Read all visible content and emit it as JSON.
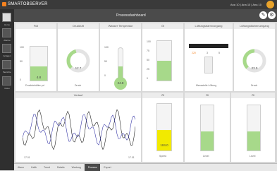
{
  "brand": "SMARTOBSERVER",
  "topright": "Ana 10 | Ana 10 | Ana 10",
  "page_title": "Prozessdashboard",
  "colors": {
    "green": "#a7d98a",
    "yellow": "#f2ea00",
    "orange": "#f5821f"
  },
  "sidebar": [
    {
      "label": "Home"
    },
    {
      "label": "Alarme"
    },
    {
      "label": "Anlagen"
    },
    {
      "label": "Berichte"
    },
    {
      "label": "Doku"
    }
  ],
  "panels": {
    "tank1": {
      "title": "Füll",
      "value": "4.8",
      "caption": "Druckbehälter pd",
      "scale": [
        "100",
        "50",
        "0"
      ],
      "level": 0.42
    },
    "gauge1": {
      "title": "Druckluft",
      "value": "12.7",
      "caption": "Druck",
      "level": 0.45
    },
    "thermo": {
      "title": "Wasser Temperatur",
      "value": "24.8",
      "caption": "Temperatur",
      "scale": [
        "100",
        "50",
        "0"
      ],
      "level": 0.42
    },
    "tank2": {
      "title": "Öl",
      "value": "",
      "caption": "",
      "scale": [
        "100",
        "75",
        "50",
        "25",
        "0"
      ],
      "level": 0.5
    },
    "flow": {
      "title": "Lüftungsbarmvorgang",
      "value1": "220",
      "value2": "3",
      "value3": "5",
      "caption": "Messstelle Lüftung",
      "scale": [
        "100",
        "0"
      ]
    },
    "gauge2": {
      "title": "Lüftungsfächenumgang",
      "value": "23.0",
      "caption": "Druck",
      "level": 0.5
    },
    "chart": {
      "title": "Verlauf",
      "xstart": "17.01",
      "xend": "17.01",
      "yleft": [
        "100",
        "75",
        "50",
        "25",
        "0"
      ],
      "yright": [
        "100",
        "80",
        "60",
        "40",
        "20",
        "0"
      ]
    },
    "tank3": {
      "title": "Öl",
      "value": "104.0",
      "caption": "Speed",
      "scale": [
        "100",
        "75",
        "50",
        "25",
        "0"
      ],
      "level": 0.44
    },
    "tank4": {
      "title": "Öl",
      "value": "",
      "caption": "Level",
      "scale": [
        "100",
        "75",
        "50",
        "25",
        "0"
      ],
      "level": 0.42
    },
    "tank5": {
      "title": "Öl",
      "value": "",
      "caption": "Level",
      "scale": [
        "100",
        "75",
        "50",
        "25",
        "0"
      ],
      "level": 0.42
    }
  },
  "bottom_tabs": [
    "Alarm",
    "Kalib",
    "Trend",
    "Details",
    "Wartung",
    "Prozess",
    "Export"
  ],
  "active_tab": 5
}
